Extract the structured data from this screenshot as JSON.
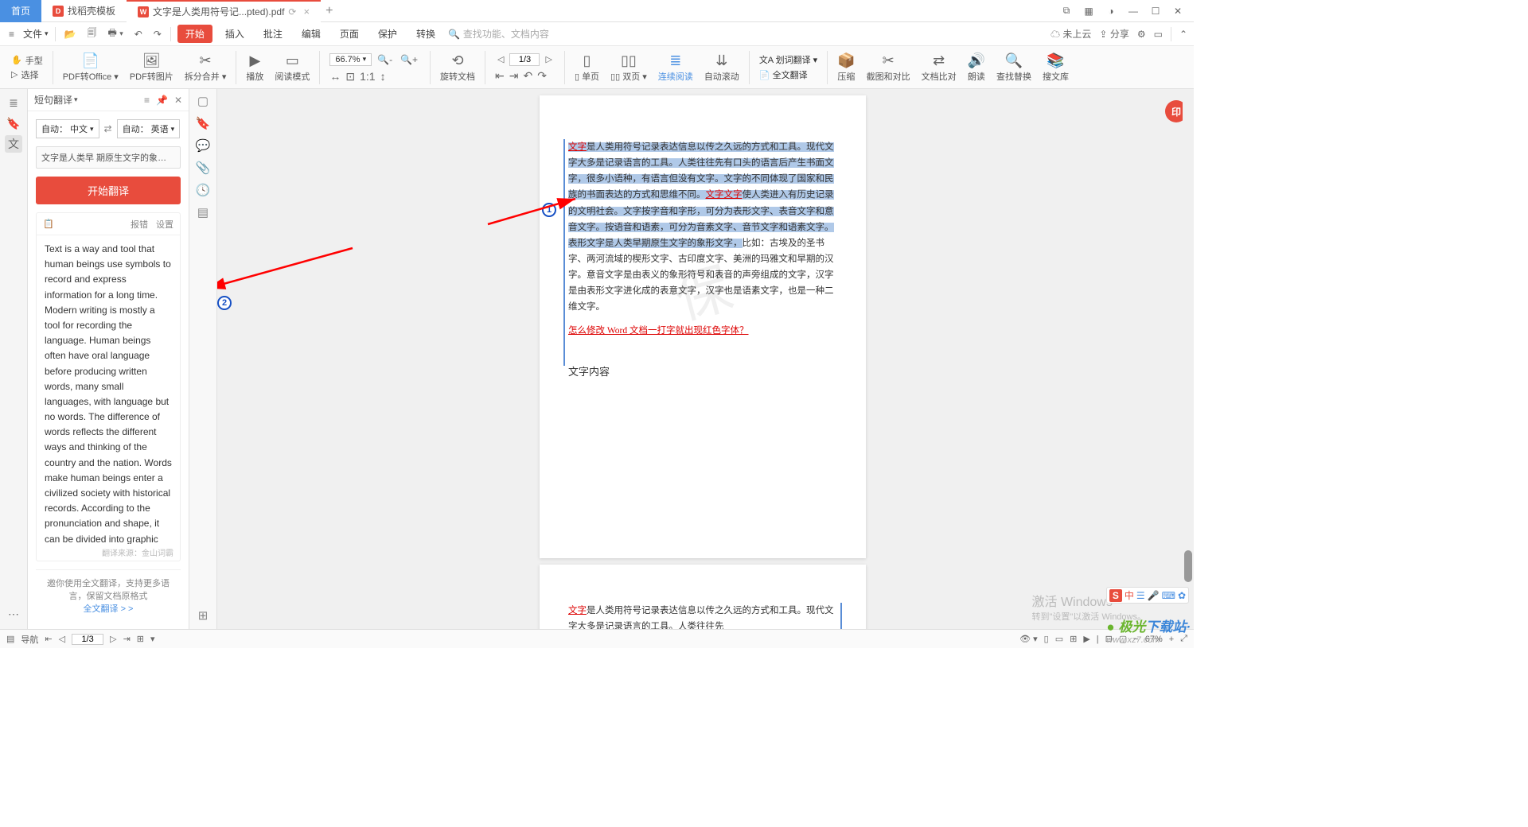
{
  "tabs": {
    "home": "首页",
    "template": "找稻壳模板",
    "active": "文字是人类用符号记...pted).pdf"
  },
  "menu": {
    "file": "文件",
    "start": "开始",
    "insert": "插入",
    "annotate": "批注",
    "edit": "编辑",
    "page": "页面",
    "protect": "保护",
    "convert": "转换",
    "search_ph": "查找功能、文档内容"
  },
  "menu_right": {
    "cloud": "未上云",
    "share": "分享"
  },
  "tool": {
    "hand": "手型",
    "select": "选择",
    "pdf2office": "PDF转Office",
    "pdf2img": "PDF转图片",
    "split": "拆分合并",
    "play": "播放",
    "readmode": "阅读模式",
    "zoom": "66.7%",
    "rotate": "旋转文档",
    "single": "单页",
    "double": "双页",
    "continuous": "连续阅读",
    "autoscroll": "自动滚动",
    "word_trans": "划词翻译",
    "full_trans": "全文翻译",
    "compress": "压缩",
    "screenshot": "截图和对比",
    "compare": "文档比对",
    "readaloud": "朗读",
    "findreplace": "查找替换",
    "wenku": "搜文库",
    "page_ind": "1/3"
  },
  "panel": {
    "title": "短句翻译",
    "lang_from_prefix": "自动：",
    "lang_from": "中文",
    "lang_to_prefix": "自动：",
    "lang_to": "英语",
    "src": "文字是人类早 期原生文字的象形文字。",
    "btn": "开始翻译",
    "report": "报错",
    "settings": "设置",
    "result": "Text is a way and tool that human beings use symbols to record and express information for a long time. Modern writing is mostly a tool for recording the language. Human beings often have oral language before producing written words, many small languages, with language but no words. The difference of words reflects the different ways and thinking of the country and the nation. Words make human beings enter a civilized society with historical records. According to the pronunciation and shape, it can be divided into graphic text, phonetic text and",
    "source": "翻译来源：金山词霸",
    "promo1": "邀你使用全文翻译，支持更多语言，保留文档原格式",
    "promo2": "全文翻译 > >"
  },
  "doc": {
    "p1_a": "文字",
    "p1_b": "是人类用符号记录表达信息以传之久远的方式和工具。现代文字大多是记录语言的工具。人类往往先有口头的语言后产生书面文字，很多小语种，有语言但没有文字。文字的不同体现了国家和民族的书面表达的方式和思维不同。",
    "p1_c": "文字文字",
    "p1_d": "使人类进入有历史记录的文明社会。文字按字音和字形，可分为表形文字、表音文字和意音文字。按语音和语素，可分为音素文字、音节文字和语素文字。表形文字是人类早期原生文字的象形文字，",
    "p1_e": "比如：古埃及的圣书字、两河流域的楔形文字、古印度文字、美洲的玛雅文和早期的汉字。意音文字是由表义的象形符号和表音的声旁组成的文字，汉字是由表形文字进化成的表意文字，汉字也是语素文字，也是一种二维文字。",
    "link": "怎么修改 Word 文档一打字就出现红色字体？",
    "heading": "文字内容",
    "p2_a": "文字",
    "p2_b": "是人类用符号记录表达信息以传之久远的方式和工具。现代文字大多是记录语言的工具。人类往往先"
  },
  "status": {
    "nav": "导航",
    "page": "1/3",
    "zoom": "67%"
  },
  "os": {
    "activate": "激活 Windows",
    "activate_sub": "转到\"设置\"以激活 Windows。",
    "dl1": "极光",
    "dl2": "下载站",
    "dlsub": "www.xz7.com"
  },
  "ime": {
    "zh": "中"
  }
}
